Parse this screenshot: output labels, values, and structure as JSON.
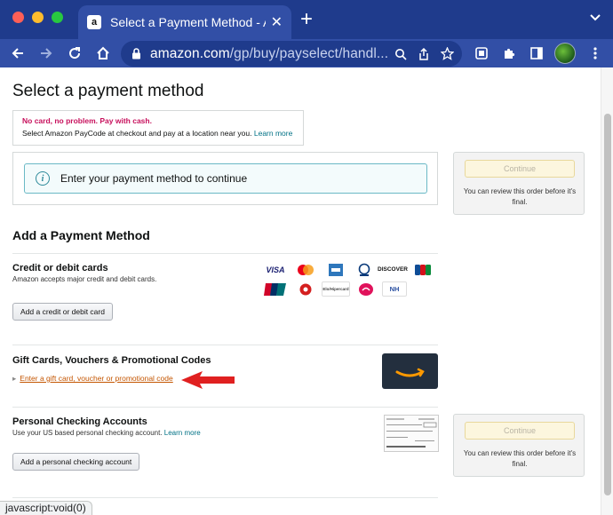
{
  "browser": {
    "tab_title": "Select a Payment Method - Am",
    "url_host": "amazon.com",
    "url_path": "/gp/buy/payselect/handl...",
    "status_text": "javascript:void(0)"
  },
  "page": {
    "title": "Select a payment method",
    "paycode": {
      "headline": "No card, no problem. Pay with cash.",
      "body": "Select Amazon PayCode at checkout and pay at a location near you.",
      "link": "Learn more"
    },
    "notice": "Enter your payment method to continue",
    "continue_label": "Continue",
    "review_text": "You can review this order before it's final.",
    "add_heading": "Add a Payment Method",
    "credit": {
      "title": "Credit or debit cards",
      "subtitle": "Amazon accepts major credit and debit cards.",
      "button": "Add a credit or debit card",
      "brands": [
        "VISA",
        "Mastercard",
        "Amex",
        "Diners Club",
        "DISCOVER",
        "JCB",
        "UnionPay",
        "Elo",
        "Hipercard",
        "Elo",
        "NH"
      ]
    },
    "gift": {
      "title": "Gift Cards, Vouchers & Promotional Codes",
      "link": "Enter a gift card, voucher or promotional code"
    },
    "checking": {
      "title": "Personal Checking Accounts",
      "subtitle": "Use your US based personal checking account.",
      "link": "Learn more",
      "button": "Add a personal checking account"
    }
  },
  "colors": {
    "chrome": "#324fa6",
    "arrow": "#e02020",
    "link": "#007185",
    "gift_link": "#c45500"
  }
}
